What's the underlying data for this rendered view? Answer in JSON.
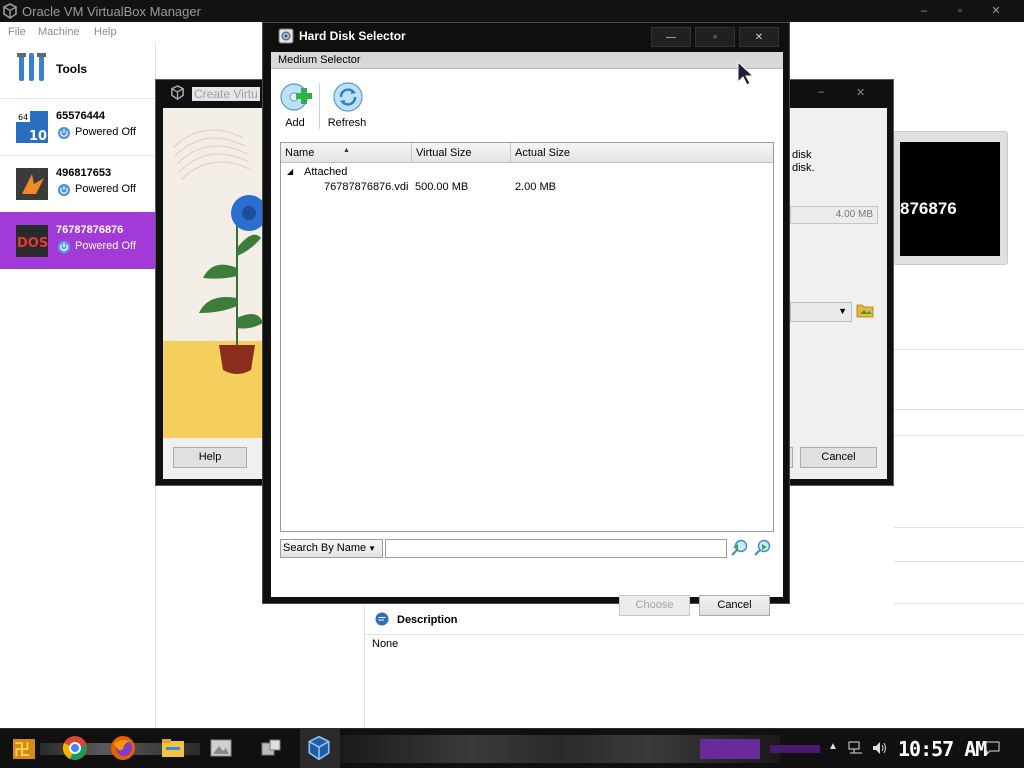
{
  "manager": {
    "title": "Oracle VM VirtualBox Manager",
    "menu": [
      "File",
      "Machine",
      "Help"
    ],
    "tools_label": "Tools",
    "vms": [
      {
        "name": "65576444",
        "state": "Powered Off",
        "selected": false
      },
      {
        "name": "496817653",
        "state": "Powered Off",
        "selected": false
      },
      {
        "name": "76787876876",
        "state": "Powered Off",
        "selected": true
      }
    ],
    "preview_text": "876876",
    "description": {
      "title": "Description",
      "value": "None"
    },
    "window_controls": [
      "–",
      "▫",
      "✕"
    ]
  },
  "wizard": {
    "title": "Create Virtu",
    "text_line1": "disk",
    "text_line2": "disk.",
    "size_value": "4.00 MB",
    "help_label": "Help",
    "cancel_label": "Cancel",
    "controls": [
      "–",
      "✕"
    ]
  },
  "selector": {
    "title": "Hard Disk Selector",
    "tab": "Medium Selector",
    "toolbar": {
      "add_label": "Add",
      "refresh_label": "Refresh"
    },
    "columns": [
      "Name",
      "Virtual Size",
      "Actual Size"
    ],
    "group_label": "Attached",
    "rows": [
      {
        "name": "76787876876.vdi",
        "virtual_size": "500.00 MB",
        "actual_size": "2.00 MB"
      }
    ],
    "search_mode": "Search By Name",
    "search_value": "",
    "choose_label": "Choose",
    "cancel_label": "Cancel",
    "controls": [
      "—",
      "▫",
      "✕"
    ]
  },
  "taskbar": {
    "clock": "10:57 AM",
    "apps": [
      "start-icon",
      "chrome-icon",
      "firefox-icon",
      "file-explorer-icon",
      "gallery-icon",
      "package-icon",
      "virtualbox-icon"
    ]
  },
  "colors": {
    "accent": "#a23ad8",
    "titlebar": "#121212",
    "taskbar": "#101010"
  }
}
